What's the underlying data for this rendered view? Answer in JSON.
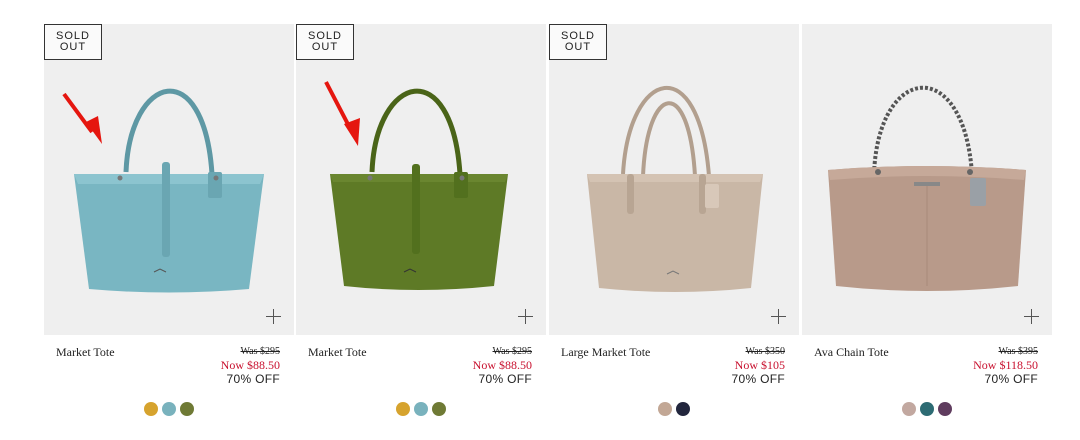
{
  "products": [
    {
      "name": "Market Tote",
      "was": "Was $295",
      "now": "Now $88.50",
      "off": "70% OFF",
      "badge_line1": "SOLD",
      "badge_line2": "OUT",
      "bag_color": "#79b6c2",
      "swatches": [
        "#d6a32e",
        "#79b2bd",
        "#6f7a35"
      ]
    },
    {
      "name": "Market Tote",
      "was": "Was $295",
      "now": "Now $88.50",
      "off": "70% OFF",
      "badge_line1": "SOLD",
      "badge_line2": "OUT",
      "bag_color": "#5e7a26",
      "swatches": [
        "#d6a32e",
        "#79b2bd",
        "#6f7a35"
      ]
    },
    {
      "name": "Large Market Tote",
      "was": "Was $350",
      "now": "Now $105",
      "off": "70% OFF",
      "badge_line1": "SOLD",
      "badge_line2": "OUT",
      "bag_color": "#c9b7a6",
      "swatches": [
        "#c2a795",
        "#22263d"
      ]
    },
    {
      "name": "Ava Chain Tote",
      "was": "Was $395",
      "now": "Now $118.50",
      "off": "70% OFF",
      "bag_color": "#b89a8a",
      "swatches": [
        "#c2a8a0",
        "#2d6b73",
        "#5f3c5e"
      ]
    }
  ],
  "icons": {
    "plus": "plus-icon",
    "arrow": "red-arrow-icon",
    "arrow_color": "#e5160f"
  }
}
